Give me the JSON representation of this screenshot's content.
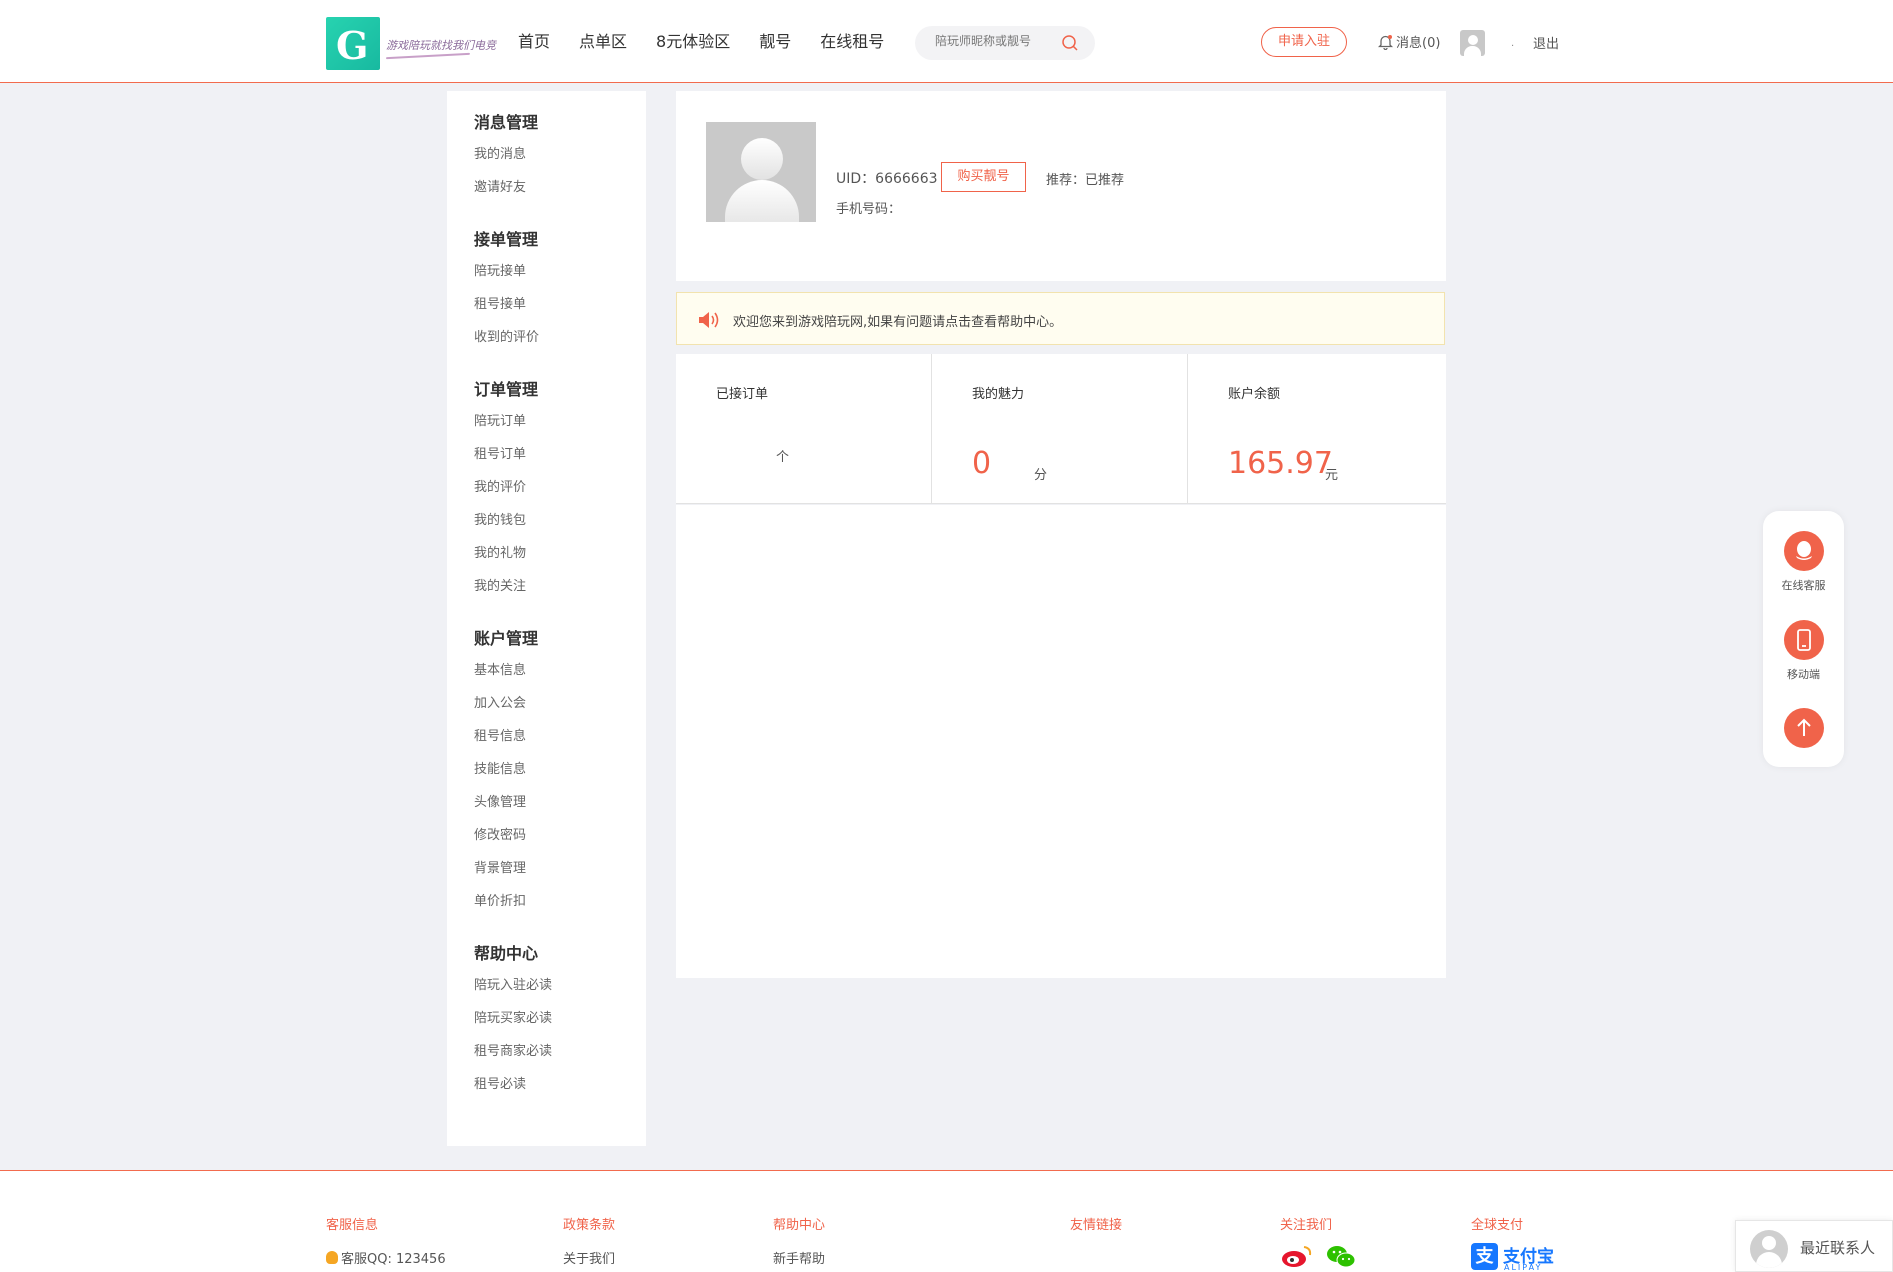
{
  "header": {
    "logo_text": "游戏陪玩就找我们电竞",
    "nav": [
      "首页",
      "点单区",
      "8元体验区",
      "靓号",
      "在线租号"
    ],
    "search_placeholder": "陪玩师昵称或靓号",
    "apply_label": "申请入驻",
    "message_label": "消息(0)",
    "separator": ".",
    "logout_label": "退出"
  },
  "sidebar": {
    "groups": [
      {
        "title": "消息管理",
        "items": [
          "我的消息",
          "邀请好友"
        ]
      },
      {
        "title": "接单管理",
        "items": [
          "陪玩接单",
          "租号接单",
          "收到的评价"
        ]
      },
      {
        "title": "订单管理",
        "items": [
          "陪玩订单",
          "租号订单",
          "我的评价",
          "我的钱包",
          "我的礼物",
          "我的关注"
        ]
      },
      {
        "title": "账户管理",
        "items": [
          "基本信息",
          "加入公会",
          "租号信息",
          "技能信息",
          "头像管理",
          "修改密码",
          "背景管理",
          "单价折扣"
        ]
      },
      {
        "title": "帮助中心",
        "items": [
          "陪玩入驻必读",
          "陪玩买家必读",
          "租号商家必读",
          "租号必读"
        ]
      }
    ]
  },
  "profile": {
    "uid_text": "UID：6666663",
    "buy_label": "购买靓号",
    "recommend_text": "推荐：已推荐",
    "phone_text": "手机号码："
  },
  "notice": {
    "text": "欢迎您来到游戏陪玩网,如果有问题请点击查看帮助中心。"
  },
  "stats": {
    "orders": {
      "label": "已接订单",
      "value": "",
      "unit": "个"
    },
    "charm": {
      "label": "我的魅力",
      "value": "0",
      "unit": "分"
    },
    "balance": {
      "label": "账户余额",
      "value": "165.97",
      "unit": "元"
    }
  },
  "float": {
    "service_label": "在线客服",
    "mobile_label": "移动端"
  },
  "footer": {
    "cols": [
      {
        "title": "客服信息",
        "link": "客服QQ: 123456"
      },
      {
        "title": "政策条款",
        "link": "关于我们"
      },
      {
        "title": "帮助中心",
        "link": "新手帮助"
      },
      {
        "title": "友情链接",
        "link": ""
      },
      {
        "title": "关注我们",
        "link": ""
      },
      {
        "title": "全球支付",
        "link": ""
      }
    ],
    "alipay_text": "支付宝",
    "alipay_sub": "ALIPAY",
    "recent_contacts": "最近联系人"
  },
  "colors": {
    "accent": "#f0634a",
    "notice_bg": "#fffdf0",
    "page_bg": "#f0f1f5"
  }
}
